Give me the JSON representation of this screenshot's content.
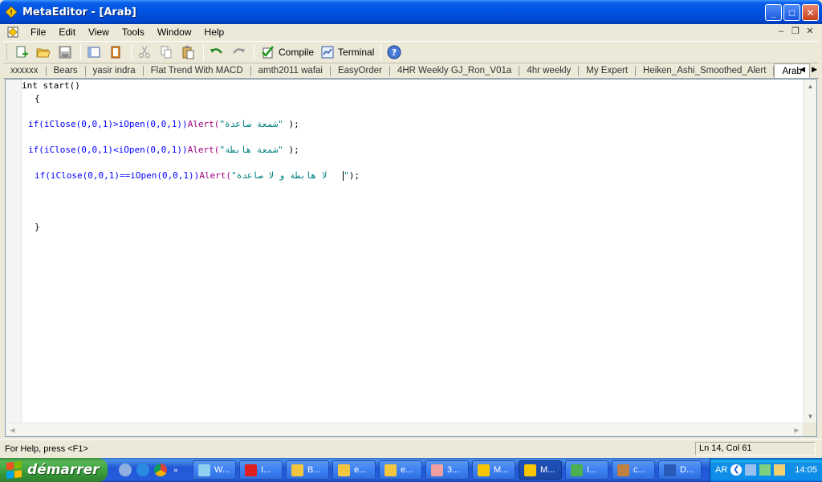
{
  "window": {
    "title": "MetaEditor - [Arab]"
  },
  "menu": [
    "File",
    "Edit",
    "View",
    "Tools",
    "Window",
    "Help"
  ],
  "toolbar": {
    "compile_label": "Compile",
    "terminal_label": "Terminal"
  },
  "tabs": [
    "xxxxxx",
    "Bears",
    "yasir indra",
    "Flat Trend With MACD",
    "amth2011 wafai",
    "EasyOrder",
    "4HR Weekly GJ_Ron_V01a",
    "4hr weekly",
    "My Expert",
    "Heiken_Ashi_Smoothed_Alert",
    "Arab"
  ],
  "active_tab": "Arab",
  "code": {
    "line1": "int start()",
    "line2": "{",
    "line3": {
      "pre": "if(iClose(0,0,1)>iOpen(0,0,1))",
      "alert": "Alert(",
      "str": "\"شمعة صاعدة\"",
      "post": " );"
    },
    "line4": {
      "pre": "if(iClose(0,0,1)<iOpen(0,0,1))",
      "alert": "Alert(",
      "str": "\"شمعة هابطة\"",
      "post": " );"
    },
    "line5": {
      "pre": "if(iClose(0,0,1)==iOpen(0,0,1))",
      "alert": "Alert(",
      "str": "\"لا هابطة و لا صاعدة   ",
      "strend": "\"",
      "post": ");"
    },
    "line6": "}"
  },
  "status": {
    "help": "For Help, press <F1>",
    "position": "Ln 14, Col 61"
  },
  "taskbar": {
    "start_label": "démarrer",
    "tasks": [
      {
        "label": "W...",
        "icon": "weather-icon",
        "active": false
      },
      {
        "label": "I...",
        "icon": "opera-icon",
        "active": false
      },
      {
        "label": "B...",
        "icon": "folder-icon",
        "active": false
      },
      {
        "label": "e...",
        "icon": "folder-icon",
        "active": false
      },
      {
        "label": "e...",
        "icon": "folder-icon",
        "active": false
      },
      {
        "label": "3...",
        "icon": "image-icon",
        "active": false
      },
      {
        "label": "M...",
        "icon": "metaeditor-icon",
        "active": false
      },
      {
        "label": "M...",
        "icon": "metaeditor-icon",
        "active": true
      },
      {
        "label": "I...",
        "icon": "chrome-icon",
        "active": false
      },
      {
        "label": "c...",
        "icon": "app-icon",
        "active": false
      },
      {
        "label": "D...",
        "icon": "word-icon",
        "active": false
      }
    ],
    "language": "AR",
    "clock": "14:05"
  },
  "colors": {
    "keyword_fn": "#0000ff",
    "alert": "#a00080",
    "string": "#008080",
    "title_bar": "#0054e3",
    "taskbar": "#245edb",
    "start_button": "#3a9c3a"
  }
}
